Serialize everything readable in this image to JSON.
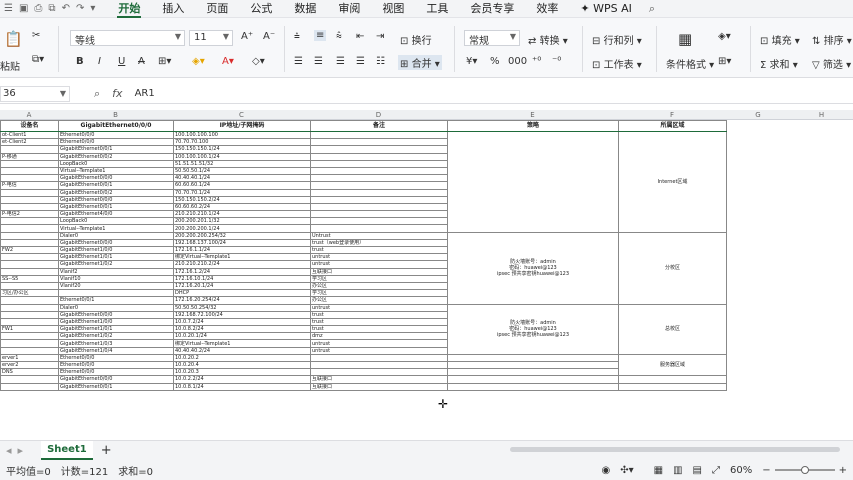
{
  "menubar": {
    "menus": [
      "开始",
      "插入",
      "页面",
      "公式",
      "数据",
      "审阅",
      "视图",
      "工具",
      "会员专享",
      "效率"
    ],
    "active_menu": "开始",
    "wps_ai": "WPS AI"
  },
  "ribbon": {
    "paste_label": "粘贴",
    "font_name": "等线",
    "font_size": "11",
    "wrap_label": "换行",
    "merge_label": "合并",
    "number_format": "常规",
    "convert_label": "转换",
    "rowcol_label": "行和列",
    "worksheet_label": "工作表",
    "cond_format_label": "条件格式",
    "fill_label": "填充",
    "sum_label": "求和",
    "sort_label": "排序",
    "filter_label": "筛选"
  },
  "formula_bar": {
    "name_box": "36",
    "fx": "fx",
    "content": "AR1"
  },
  "columns": [
    "A",
    "B",
    "C",
    "D",
    "E",
    "F",
    "G",
    "H"
  ],
  "table": {
    "headers": [
      "设备名",
      "GigabitEthernet0/0/0",
      "IP地址/子网掩码",
      "备注",
      "策略",
      "所属区域"
    ],
    "rows": [
      [
        "ot-Client1",
        "Ethernet0/0/0",
        "100.100.100.100",
        "",
        ""
      ],
      [
        "et-Client2",
        "Ethernet0/0/0",
        "70.70.70.100",
        "",
        ""
      ],
      [
        "",
        "GigabitEthernet0/0/1",
        "150.150.150.1/24",
        "",
        ""
      ],
      [
        "P-移通",
        "GigabitEthernet0/0/2",
        "100.100.100.1/24",
        "",
        ""
      ],
      [
        "",
        "LoopBack0",
        "51.51.51.51/32",
        "",
        ""
      ],
      [
        "",
        "Virtual--Template1",
        "50.50.50.1/24",
        "",
        ""
      ],
      [
        "",
        "GigabitEthernet0/0/0",
        "40.40.40.1/24",
        "",
        ""
      ],
      [
        "P-电信",
        "GigabitEthernet0/0/1",
        "60.60.60.1/24",
        "",
        ""
      ],
      [
        "",
        "GigabitEthernet0/0/2",
        "70.70.70.1/24",
        "",
        ""
      ],
      [
        "",
        "GigabitEthernet0/0/0",
        "150.150.150.2/24",
        "",
        ""
      ],
      [
        "",
        "GigabitEthernet0/0/1",
        "60.60.60.2/24",
        "",
        ""
      ],
      [
        "P-电信2",
        "GigabitEthernet4/0/0",
        "210.210.210.1/24",
        "",
        ""
      ],
      [
        "",
        "LoopBack0",
        "200.200.201.1/32",
        "",
        ""
      ],
      [
        "",
        "Virtual--Template1",
        "200.200.200.1/24",
        "",
        ""
      ],
      [
        "",
        "Dialer0",
        "200.200.200.254/32",
        "Untrust",
        ""
      ],
      [
        "",
        "GigabitEthernet0/0/0",
        "192.168.137.100/24",
        "trust（web登录使用）",
        ""
      ],
      [
        "FW2",
        "GigabitEthernet1/0/0",
        "172.16.1.1/24",
        "trust",
        ""
      ],
      [
        "",
        "GigabitEthernet1/0/1",
        "绑定Virtual--Template1",
        "untrust",
        ""
      ],
      [
        "",
        "GigabitEthernet1/0/2",
        "210.210.210.2/24",
        "untrust",
        ""
      ],
      [
        "",
        "Vlanif2",
        "172.16.1.2/24",
        "互联接口",
        ""
      ],
      [
        "SS--S5",
        "Vlanif10",
        "172.16.10.1/24",
        "学习区",
        ""
      ],
      [
        "",
        "Vlanif20",
        "172.16.20.1/24",
        "办公区",
        ""
      ],
      [
        "习区/办公区",
        "",
        "DHCP",
        "学习区",
        ""
      ],
      [
        "",
        "Ethernet0/0/1",
        "172.16.20.254/24",
        "办公区",
        ""
      ],
      [
        "",
        "Dialer0",
        "50.50.50.254/32",
        "untrust",
        ""
      ],
      [
        "",
        "GigabitEthernet0/0/0",
        "192.168.72.100/24",
        "trust",
        ""
      ],
      [
        "",
        "GigabitEthernet1/0/0",
        "10.0.7.2/24",
        "trust",
        ""
      ],
      [
        "FW1",
        "GigabitEthernet1/0/1",
        "10.0.8.2/24",
        "trust",
        ""
      ],
      [
        "",
        "GigabitEthernet1/0/2",
        "10.0.20.1/24",
        "dmz",
        ""
      ],
      [
        "",
        "GigabitEthernet1/0/3",
        "绑定Virtual--Template1",
        "untrust",
        ""
      ],
      [
        "",
        "GigabitEthernet1/0/4",
        "40.40.40.2/24",
        "untrust",
        ""
      ],
      [
        "erver1",
        "Ethernet0/0/0",
        "10.0.20.2",
        "",
        ""
      ],
      [
        "erver2",
        "Ethernet0/0/0",
        "10.0.20.4",
        "",
        ""
      ],
      [
        "DNS",
        "Ethernet0/0/0",
        "10.0.20.3",
        "",
        ""
      ],
      [
        "",
        "GigabitEthernet0/0/0",
        "10.0.2.2/24",
        "互联接口",
        ""
      ],
      [
        "",
        "GigabitEthernet0/0/1",
        "10.0.8.1/24",
        "互联接口",
        ""
      ]
    ],
    "policy_fw2": [
      "防火墙账号：admin",
      "密码：huawei@123",
      "ipsec 预共享密钥huawei@123"
    ],
    "policy_fw1": [
      "防火墙账号：admin",
      "密码：huawei@123",
      "ipsec 预共享密钥huawei@123"
    ],
    "zone_internet": "Internet区域",
    "zone_branch": "分校区",
    "zone_main": "总校区",
    "zone_server": "服务器区域"
  },
  "sheet_tabs": {
    "active": "Sheet1",
    "add": "+"
  },
  "status": {
    "avg": "平均值=0",
    "count": "计数=121",
    "sum": "求和=0",
    "zoom": "60%"
  }
}
